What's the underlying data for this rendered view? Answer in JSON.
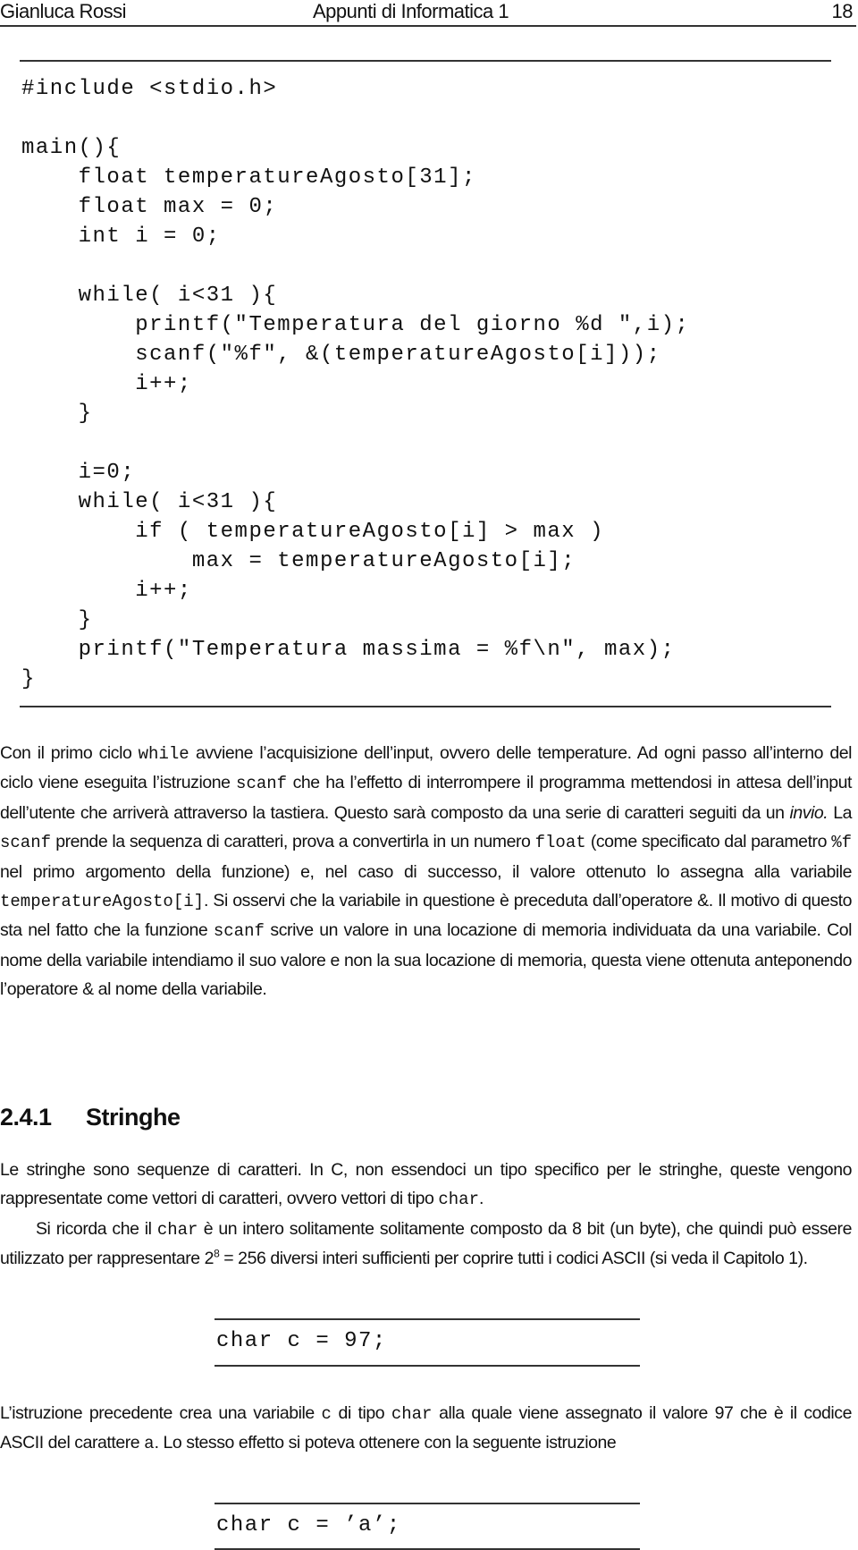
{
  "header": {
    "author": "Gianluca Rossi",
    "title": "Appunti di Informatica 1",
    "page_number": "18"
  },
  "listing_main": {
    "lines": [
      "#include <stdio.h>",
      "",
      "main(){",
      "    float temperatureAgosto[31];",
      "    float max = 0;",
      "    int i = 0;",
      "",
      "    while( i<31 ){",
      "        printf(\"Temperatura del giorno %d \",i);",
      "        scanf(\"%f\", &(temperatureAgosto[i]));",
      "        i++;",
      "    }",
      "",
      "    i=0;",
      "    while( i<31 ){",
      "        if ( temperatureAgosto[i] > max )",
      "            max = temperatureAgosto[i];",
      "        i++;",
      "    }",
      "    printf(\"Temperatura massima = %f\\n\", max);",
      "}"
    ]
  },
  "paragraph1": {
    "t1": "Con il primo ciclo ",
    "c1": "while",
    "t2": " avviene l’acquisizione dell’input, ovvero delle temperature.  Ad ogni passo all’interno del ciclo viene eseguita l’istruzione ",
    "c2": "scanf",
    "t3": " che ha l’effetto di interrompere il programma mettendosi in attesa dell’input dell’utente che arriverà attraverso la tastiera. Questo sarà composto da una serie di caratteri seguiti da un ",
    "em1": "invio.",
    "t4": "  La ",
    "c3": "scanf",
    "t5": " prende la sequenza di caratteri, prova a convertirla in un numero ",
    "c4": "float",
    "t6": " (come specificato dal parametro ",
    "c5": "%f",
    "t7": " nel primo argomento della funzione) e, nel caso di successo, il valore ottenuto lo assegna alla variabile ",
    "c6": "temperatureAgosto[i]",
    "t8": ".  Si osservi che la variabile in questione è preceduta dall’operatore &.  Il motivo di questo sta nel fatto che la funzione ",
    "c7": "scanf",
    "t9": " scrive un valore in una locazione di memoria individuata da una variabile.  Col nome della variabile intendiamo il suo valore e non la sua locazione di memoria, questa viene ottenuta anteponendo l’operatore & al nome della variabile."
  },
  "section": {
    "number": "2.4.1",
    "title": "Stringhe"
  },
  "paragraph2": {
    "t1": "Le stringhe sono sequenze di caratteri.  In C, non essendoci un tipo specifico per le stringhe, queste vengono rappresentate come vettori di caratteri, ovvero vettori di tipo ",
    "c1": "char",
    "t2": "."
  },
  "paragraph3": {
    "t1": "Si ricorda che il ",
    "c1": "char",
    "t2": " è un intero solitamente solitamente composto da 8 bit (un byte), che quindi può essere utilizzato per rappresentare 2",
    "sup": "8",
    "t3": " = 256 diversi interi sufficienti per coprire tutti i codici ASCII (si veda il Capitolo 1)."
  },
  "listing_char1": {
    "code": "char c = 97;"
  },
  "paragraph4": {
    "t1": "L’istruzione precedente crea una variabile ",
    "c1": "c",
    "t2": " di tipo ",
    "c2": "char",
    "t3": " alla quale viene assegnato il valore 97 che è il codice ASCII del carattere ",
    "c3": "a",
    "t4": ".  Lo stesso effetto si poteva ottenere con la seguente istruzione"
  },
  "listing_char2": {
    "code": "char c = ’a’;"
  }
}
